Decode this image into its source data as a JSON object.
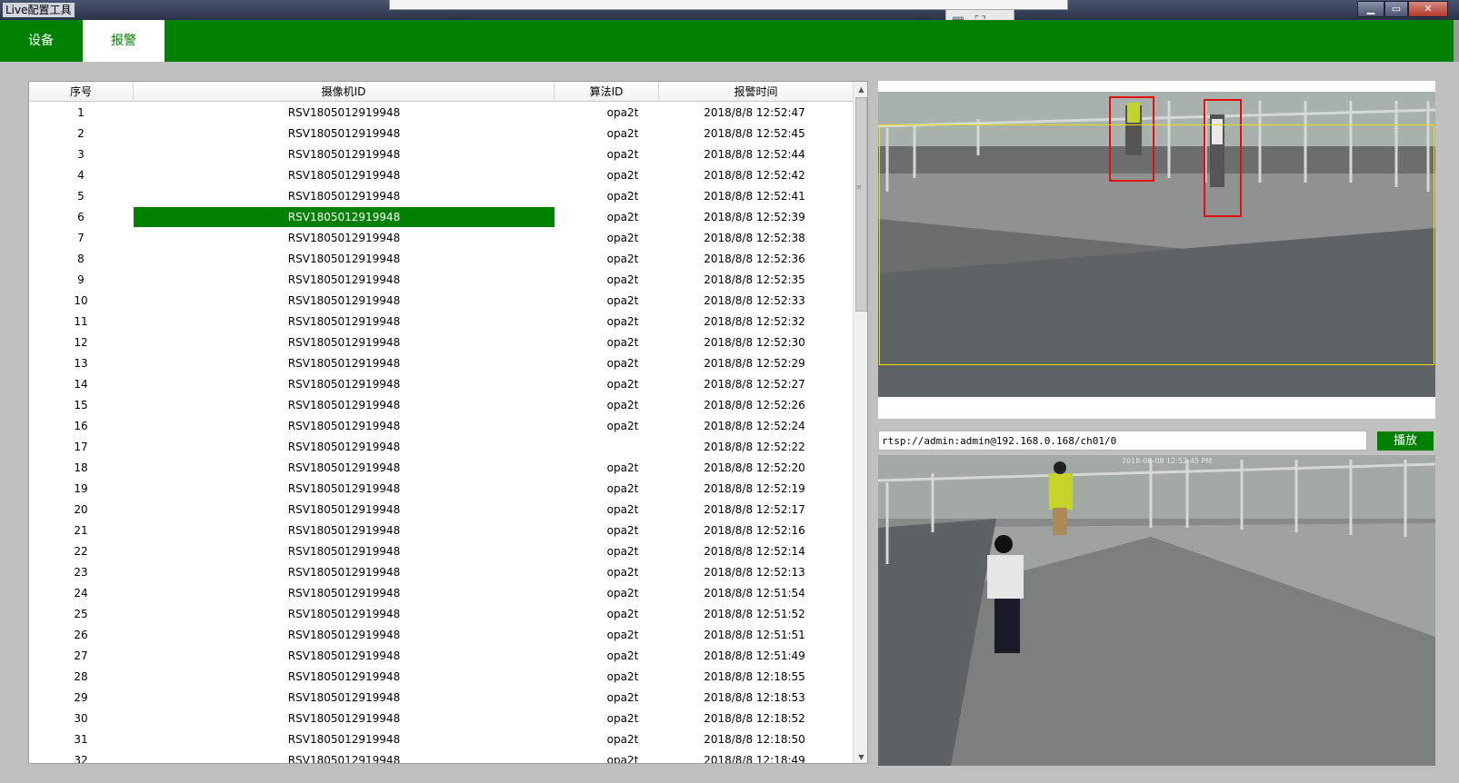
{
  "window": {
    "title": "Live配置工具",
    "min": "▁",
    "max": "▭",
    "close": "✕"
  },
  "floatbar": {
    "grid": "▦",
    "fullscreen": "⛶",
    "collapse": "︿"
  },
  "tabs": [
    {
      "label": "设备"
    },
    {
      "label": "报警"
    }
  ],
  "table": {
    "headers": {
      "index": "序号",
      "camera": "摄像机ID",
      "algo": "算法ID",
      "time": "报警时间"
    },
    "rows": [
      {
        "n": "1",
        "cam": "RSV1805012919948",
        "algo": "opa2t",
        "time": "2018/8/8 12:52:47"
      },
      {
        "n": "2",
        "cam": "RSV1805012919948",
        "algo": "opa2t",
        "time": "2018/8/8 12:52:45"
      },
      {
        "n": "3",
        "cam": "RSV1805012919948",
        "algo": "opa2t",
        "time": "2018/8/8 12:52:44"
      },
      {
        "n": "4",
        "cam": "RSV1805012919948",
        "algo": "opa2t",
        "time": "2018/8/8 12:52:42"
      },
      {
        "n": "5",
        "cam": "RSV1805012919948",
        "algo": "opa2t",
        "time": "2018/8/8 12:52:41"
      },
      {
        "n": "6",
        "cam": "RSV1805012919948",
        "algo": "opa2t",
        "time": "2018/8/8 12:52:39"
      },
      {
        "n": "7",
        "cam": "RSV1805012919948",
        "algo": "opa2t",
        "time": "2018/8/8 12:52:38"
      },
      {
        "n": "8",
        "cam": "RSV1805012919948",
        "algo": "opa2t",
        "time": "2018/8/8 12:52:36"
      },
      {
        "n": "9",
        "cam": "RSV1805012919948",
        "algo": "opa2t",
        "time": "2018/8/8 12:52:35"
      },
      {
        "n": "10",
        "cam": "RSV1805012919948",
        "algo": "opa2t",
        "time": "2018/8/8 12:52:33"
      },
      {
        "n": "11",
        "cam": "RSV1805012919948",
        "algo": "opa2t",
        "time": "2018/8/8 12:52:32"
      },
      {
        "n": "12",
        "cam": "RSV1805012919948",
        "algo": "opa2t",
        "time": "2018/8/8 12:52:30"
      },
      {
        "n": "13",
        "cam": "RSV1805012919948",
        "algo": "opa2t",
        "time": "2018/8/8 12:52:29"
      },
      {
        "n": "14",
        "cam": "RSV1805012919948",
        "algo": "opa2t",
        "time": "2018/8/8 12:52:27"
      },
      {
        "n": "15",
        "cam": "RSV1805012919948",
        "algo": "opa2t",
        "time": "2018/8/8 12:52:26"
      },
      {
        "n": "16",
        "cam": "RSV1805012919948",
        "algo": "opa2t",
        "time": "2018/8/8 12:52:24"
      },
      {
        "n": "17",
        "cam": "RSV1805012919948",
        "algo": "",
        "time": "2018/8/8 12:52:22"
      },
      {
        "n": "18",
        "cam": "RSV1805012919948",
        "algo": "opa2t",
        "time": "2018/8/8 12:52:20"
      },
      {
        "n": "19",
        "cam": "RSV1805012919948",
        "algo": "opa2t",
        "time": "2018/8/8 12:52:19"
      },
      {
        "n": "20",
        "cam": "RSV1805012919948",
        "algo": "opa2t",
        "time": "2018/8/8 12:52:17"
      },
      {
        "n": "21",
        "cam": "RSV1805012919948",
        "algo": "opa2t",
        "time": "2018/8/8 12:52:16"
      },
      {
        "n": "22",
        "cam": "RSV1805012919948",
        "algo": "opa2t",
        "time": "2018/8/8 12:52:14"
      },
      {
        "n": "23",
        "cam": "RSV1805012919948",
        "algo": "opa2t",
        "time": "2018/8/8 12:52:13"
      },
      {
        "n": "24",
        "cam": "RSV1805012919948",
        "algo": "opa2t",
        "time": "2018/8/8 12:51:54"
      },
      {
        "n": "25",
        "cam": "RSV1805012919948",
        "algo": "opa2t",
        "time": "2018/8/8 12:51:52"
      },
      {
        "n": "26",
        "cam": "RSV1805012919948",
        "algo": "opa2t",
        "time": "2018/8/8 12:51:51"
      },
      {
        "n": "27",
        "cam": "RSV1805012919948",
        "algo": "opa2t",
        "time": "2018/8/8 12:51:49"
      },
      {
        "n": "28",
        "cam": "RSV1805012919948",
        "algo": "opa2t",
        "time": "2018/8/8 12:18:55"
      },
      {
        "n": "29",
        "cam": "RSV1805012919948",
        "algo": "opa2t",
        "time": "2018/8/8 12:18:53"
      },
      {
        "n": "30",
        "cam": "RSV1805012919948",
        "algo": "opa2t",
        "time": "2018/8/8 12:18:52"
      },
      {
        "n": "31",
        "cam": "RSV1805012919948",
        "algo": "opa2t",
        "time": "2018/8/8 12:18:50"
      },
      {
        "n": "32",
        "cam": "RSV1805012919948",
        "algo": "opa2t",
        "time": "2018/8/8 12:18:49"
      }
    ],
    "selected_row": 6
  },
  "stream": {
    "url": "rtsp://admin:admin@192.168.0.168/ch01/0",
    "play_label": "播放",
    "timestamp": "2018-08-08 12:52:45 PM"
  },
  "colors": {
    "accent": "#008000",
    "detection_box": "#e01010",
    "zone_box": "#f0e000"
  }
}
